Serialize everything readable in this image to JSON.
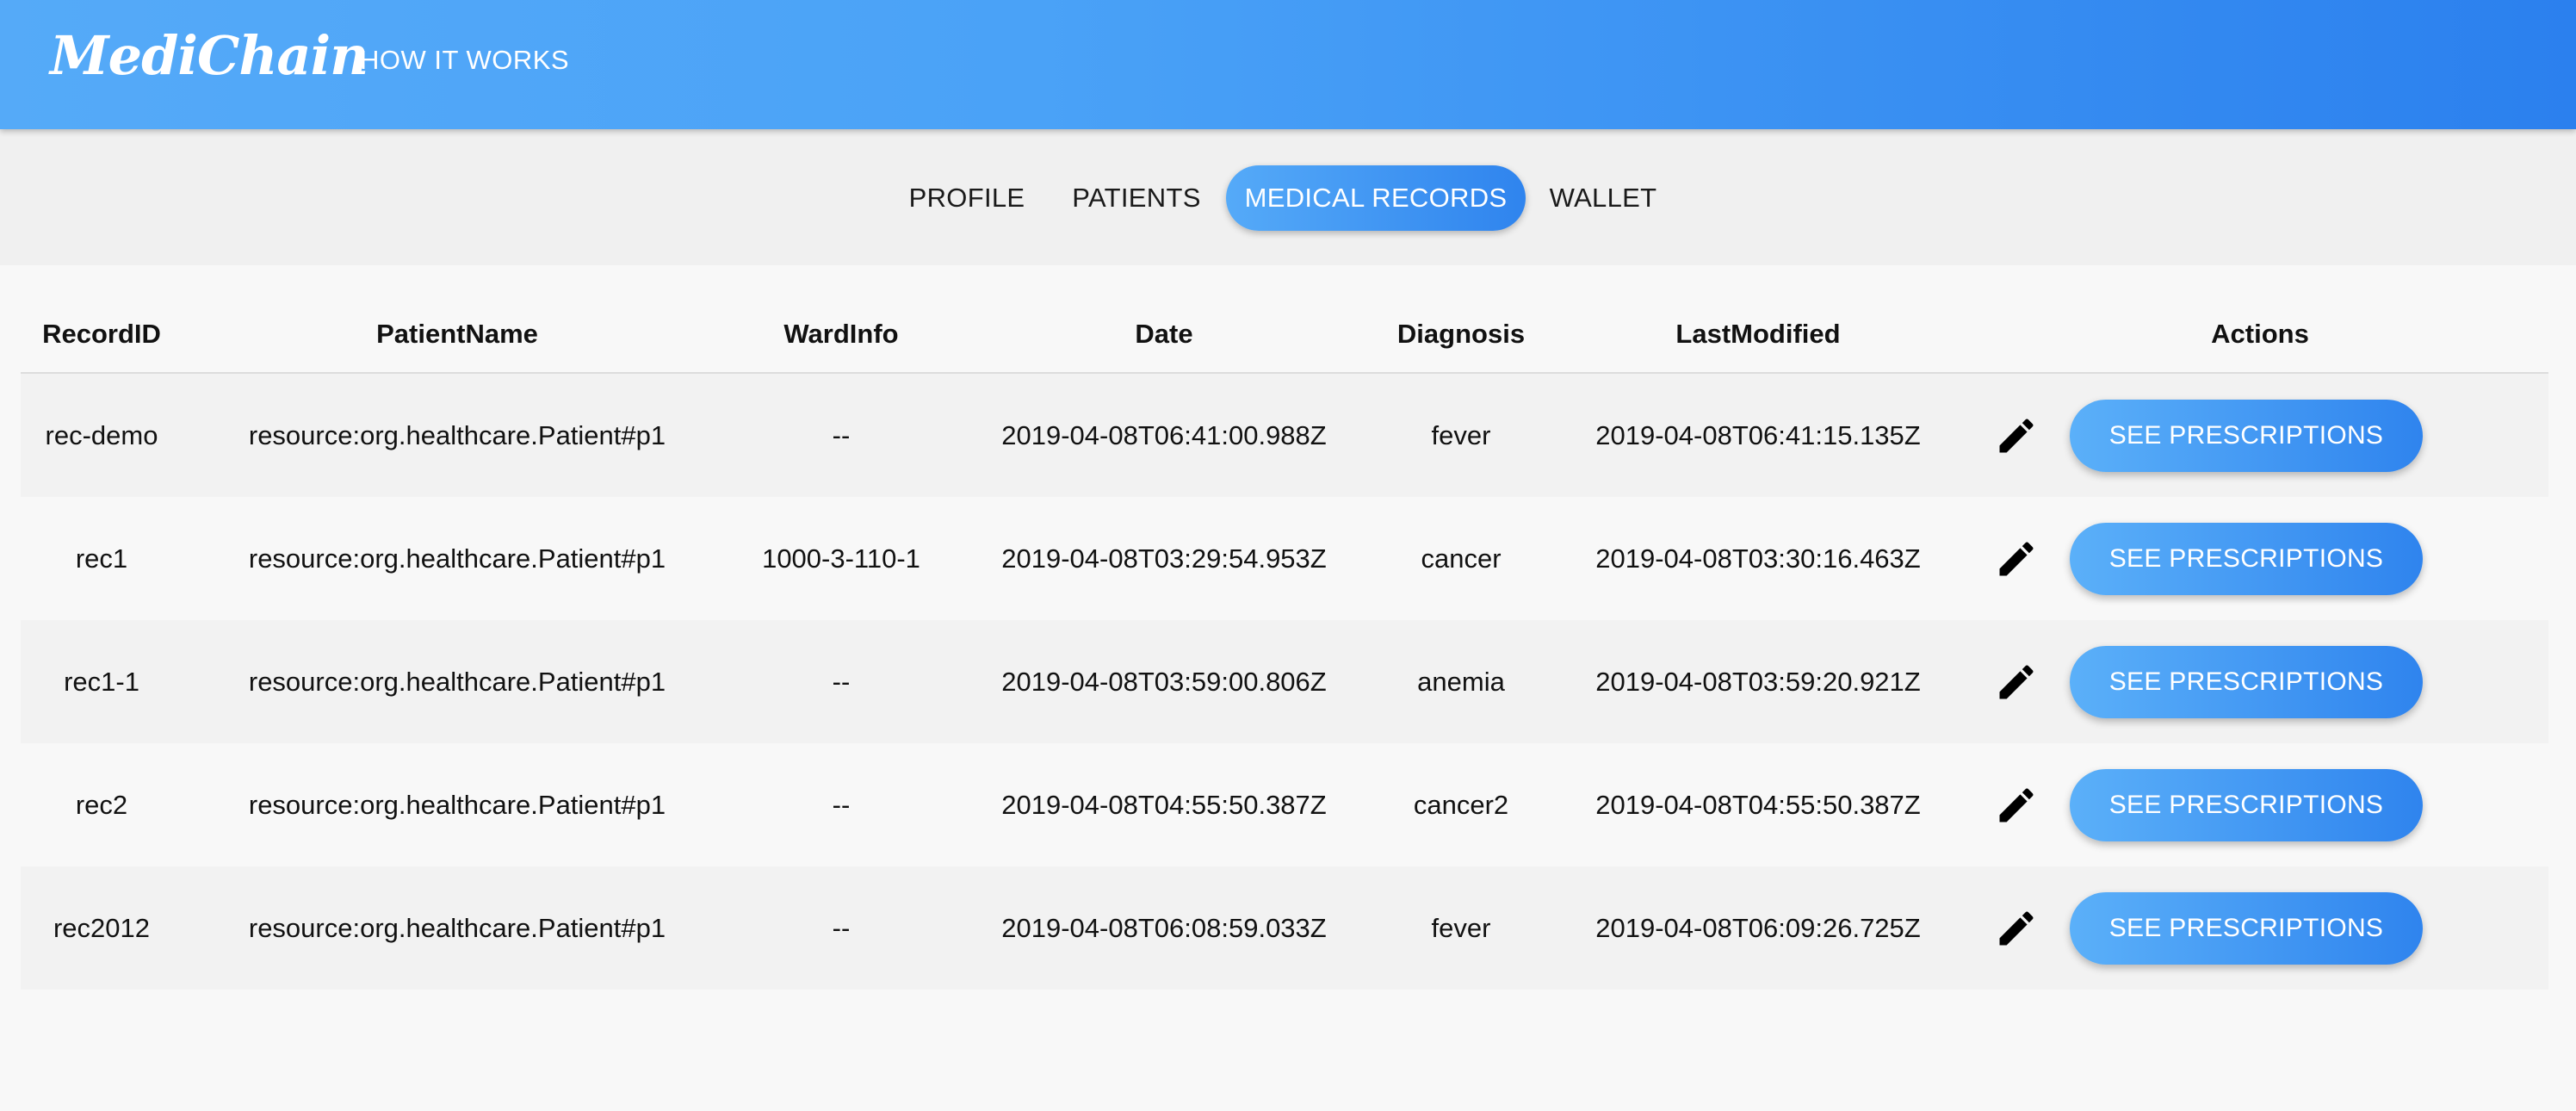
{
  "header": {
    "brand": "MediChain",
    "nav_link": "HOW IT WORKS"
  },
  "tabs": [
    {
      "label": "PROFILE",
      "active": false
    },
    {
      "label": "PATIENTS",
      "active": false
    },
    {
      "label": "MEDICAL RECORDS",
      "active": true
    },
    {
      "label": "WALLET",
      "active": false
    }
  ],
  "table": {
    "columns": [
      "RecordID",
      "PatientName",
      "WardInfo",
      "Date",
      "Diagnosis",
      "LastModified",
      "Actions"
    ],
    "rows": [
      {
        "record_id": "rec-demo",
        "patient_name": "resource:org.healthcare.Patient#p1",
        "ward_info": "--",
        "date": "2019-04-08T06:41:00.988Z",
        "diagnosis": "fever",
        "last_modified": "2019-04-08T06:41:15.135Z"
      },
      {
        "record_id": "rec1",
        "patient_name": "resource:org.healthcare.Patient#p1",
        "ward_info": "1000-3-110-1",
        "date": "2019-04-08T03:29:54.953Z",
        "diagnosis": "cancer",
        "last_modified": "2019-04-08T03:30:16.463Z"
      },
      {
        "record_id": "rec1-1",
        "patient_name": "resource:org.healthcare.Patient#p1",
        "ward_info": "--",
        "date": "2019-04-08T03:59:00.806Z",
        "diagnosis": "anemia",
        "last_modified": "2019-04-08T03:59:20.921Z"
      },
      {
        "record_id": "rec2",
        "patient_name": "resource:org.healthcare.Patient#p1",
        "ward_info": "--",
        "date": "2019-04-08T04:55:50.387Z",
        "diagnosis": "cancer2",
        "last_modified": "2019-04-08T04:55:50.387Z"
      },
      {
        "record_id": "rec2012",
        "patient_name": "resource:org.healthcare.Patient#p1",
        "ward_info": "--",
        "date": "2019-04-08T06:08:59.033Z",
        "diagnosis": "fever",
        "last_modified": "2019-04-08T06:09:26.725Z"
      }
    ],
    "action_button_label": "SEE PRESCRIPTIONS",
    "edit_icon": "pencil-icon"
  },
  "colors": {
    "header_start": "#55aaf8",
    "header_end": "#2b80ee",
    "accent": "#4aa2f7"
  }
}
